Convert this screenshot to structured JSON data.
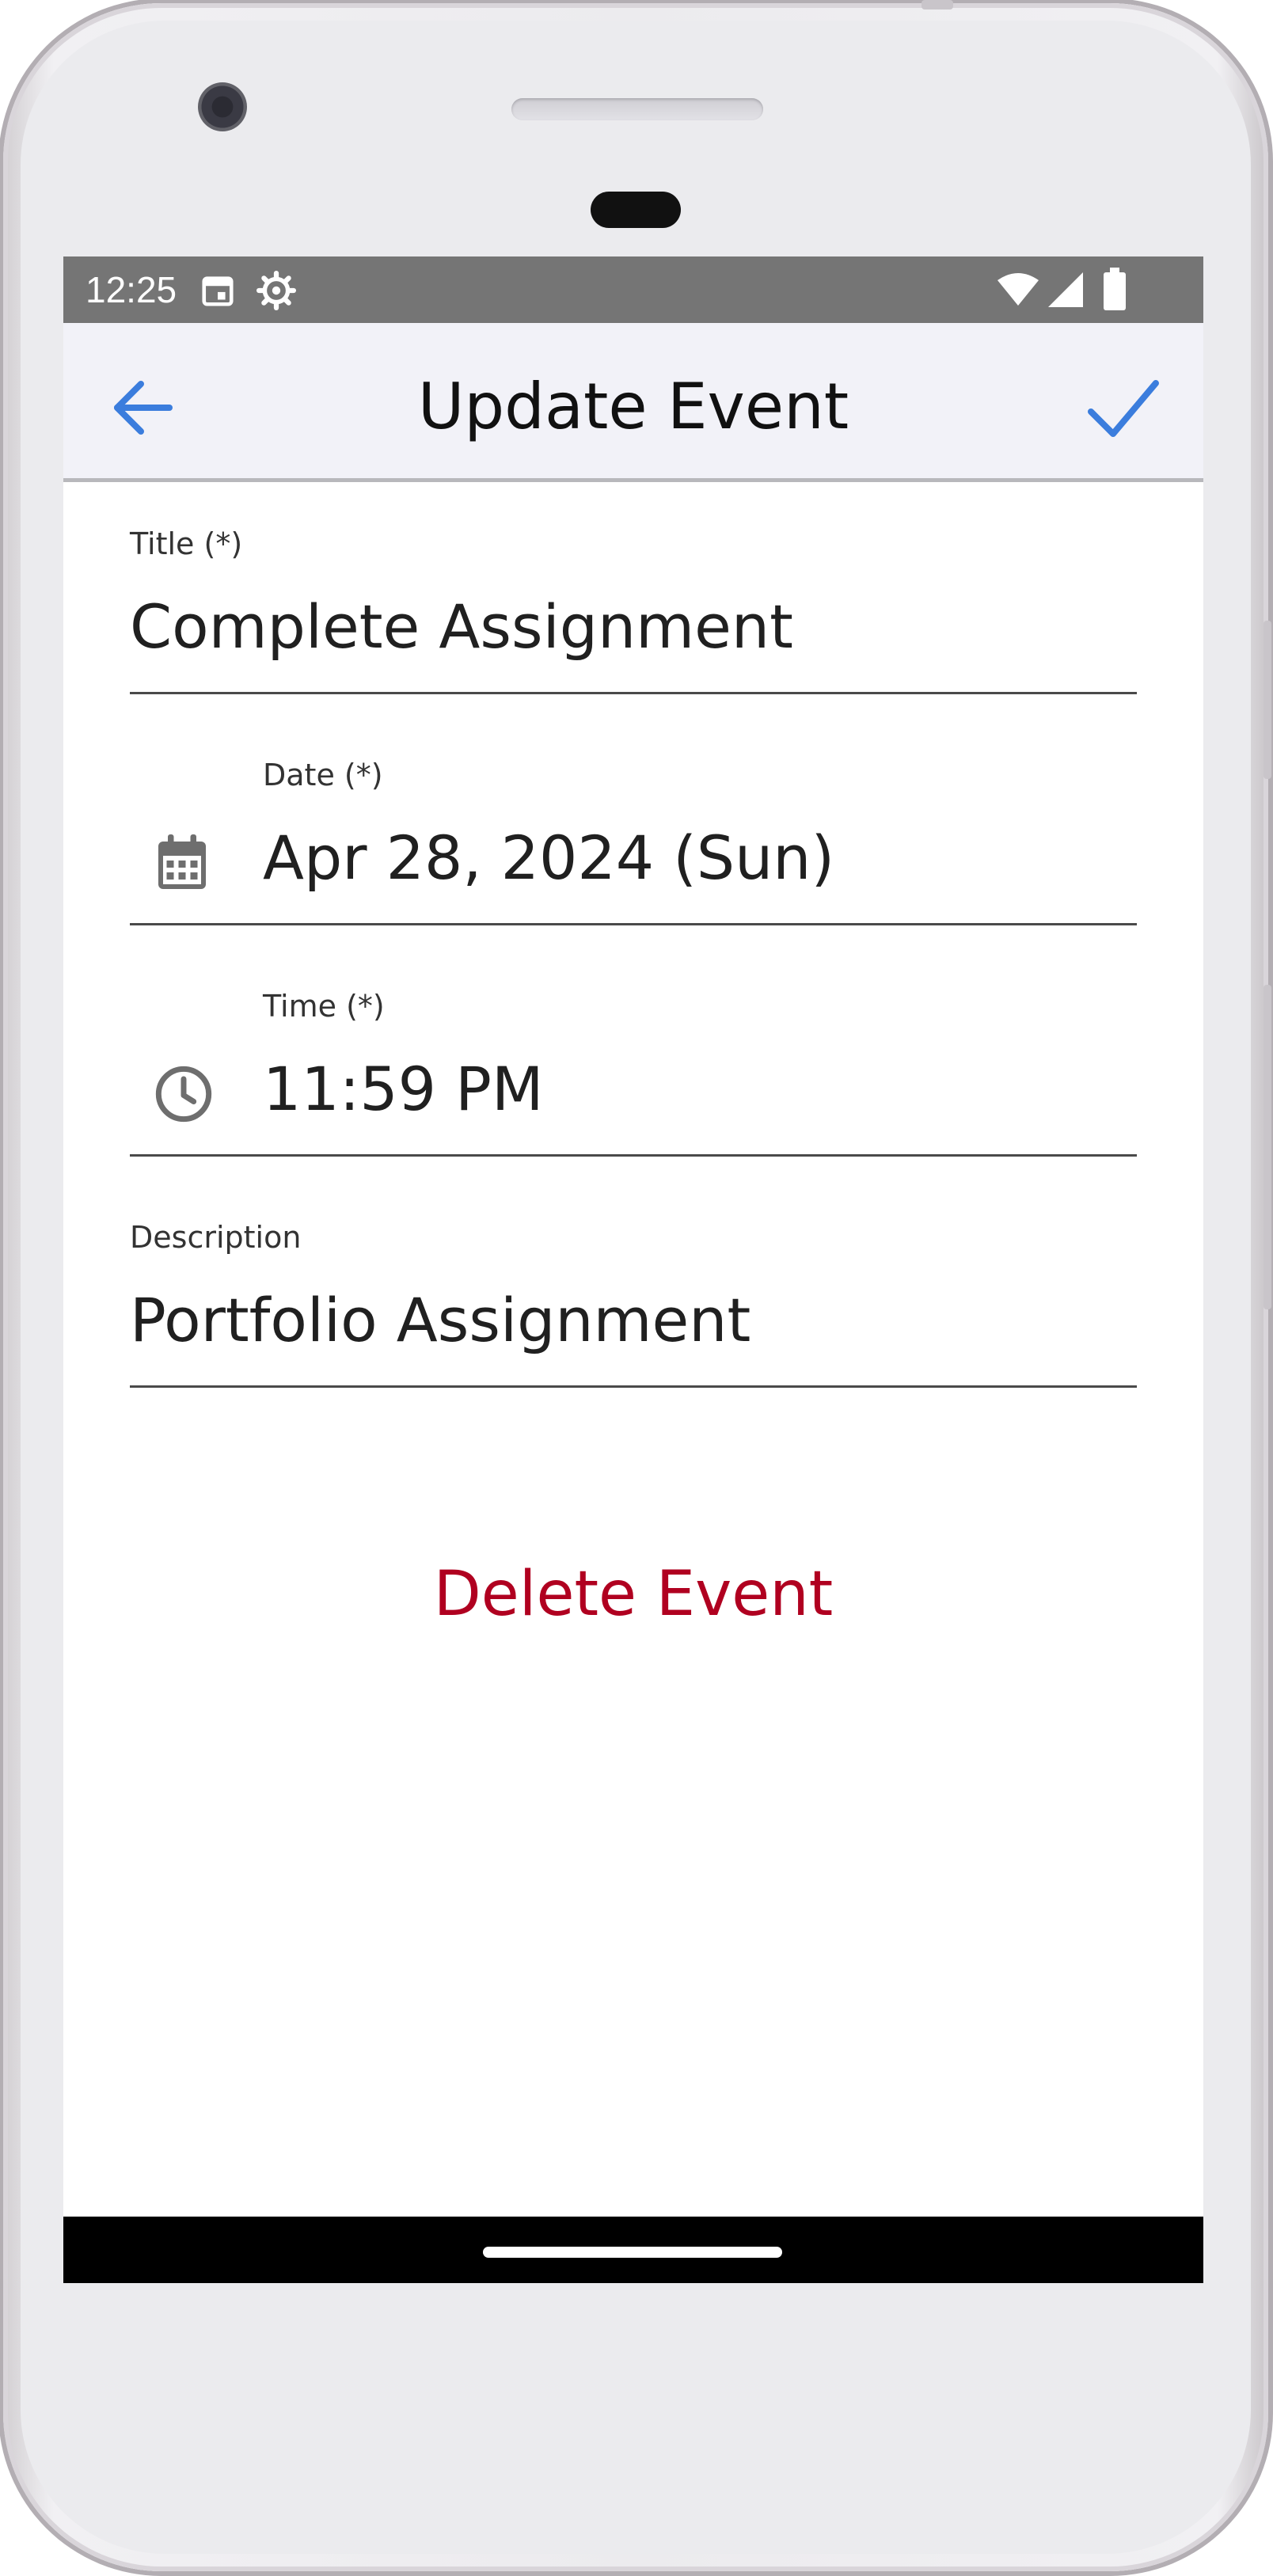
{
  "status_bar": {
    "time": "12:25",
    "icons": [
      "calendar-icon",
      "settings-icon",
      "wifi-icon",
      "signal-icon",
      "battery-icon"
    ]
  },
  "app_bar": {
    "title": "Update Event",
    "back_icon": "arrow-back-icon",
    "confirm_icon": "check-icon",
    "accent_color": "#3b7ddd"
  },
  "form": {
    "title": {
      "label": "Title (*)",
      "value": "Complete Assignment"
    },
    "date": {
      "label": "Date (*)",
      "value": "Apr 28, 2024 (Sun)",
      "icon": "calendar-icon"
    },
    "time": {
      "label": "Time (*)",
      "value": "11:59 PM",
      "icon": "clock-icon"
    },
    "description": {
      "label": "Description",
      "value": "Portfolio Assignment"
    }
  },
  "actions": {
    "delete_label": "Delete Event",
    "delete_color": "#b00020"
  }
}
